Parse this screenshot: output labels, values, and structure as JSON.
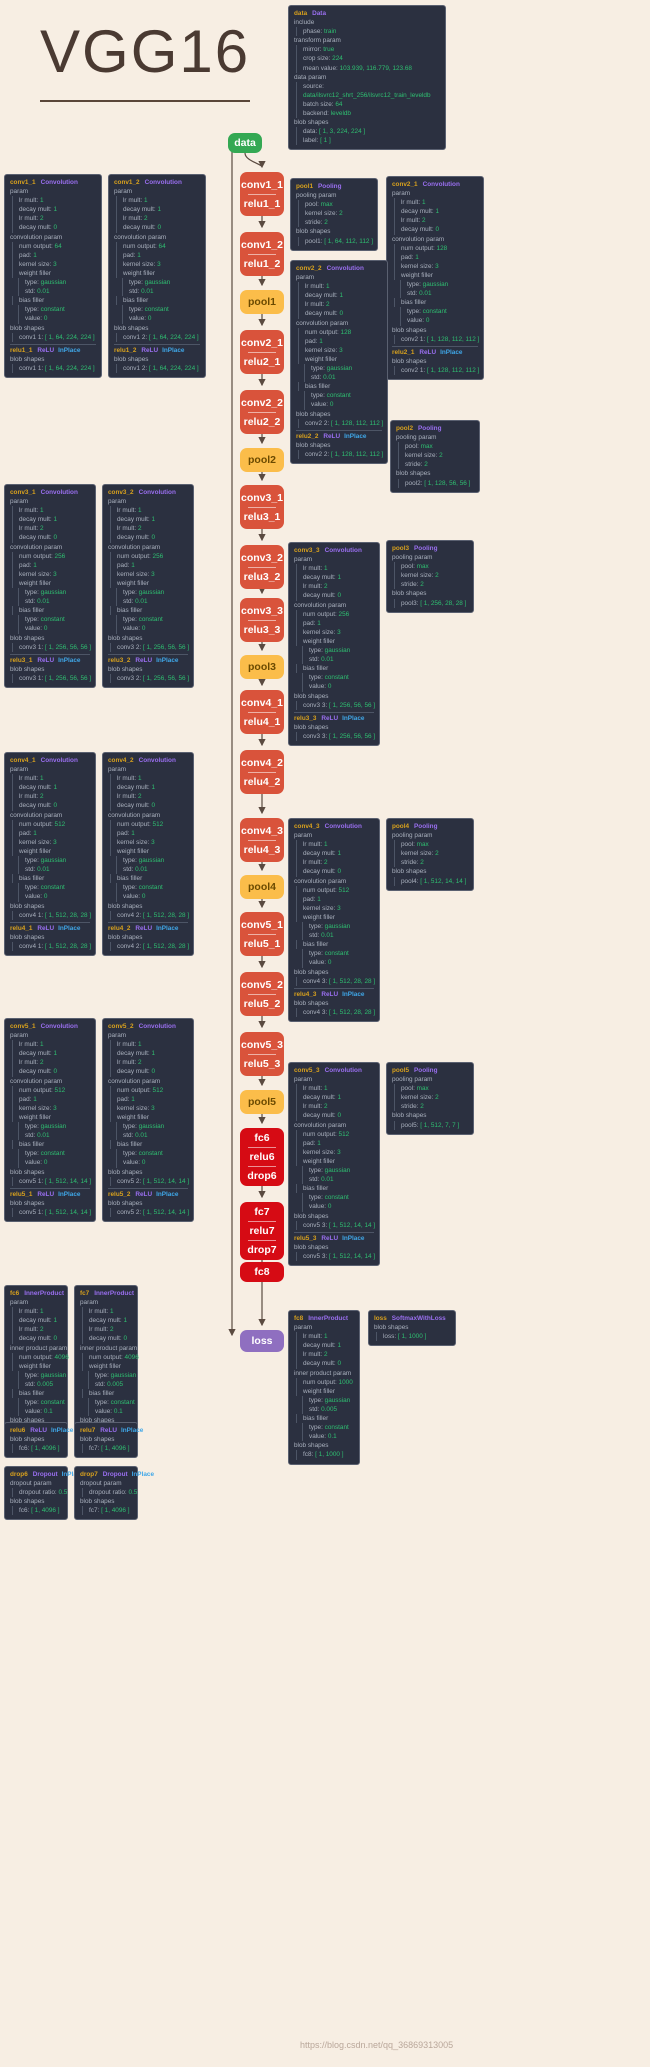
{
  "title": {
    "text": "VGG16"
  },
  "watermark": "https://blog.csdn.net/qq_36869313005",
  "colors": {
    "background": "#f7eee3",
    "card_bg": "#2b3040",
    "name": "#d8a11d",
    "type": "#9a6ff0",
    "inplace": "#3fa7e8",
    "value": "#2fbf71",
    "key": "#a9b0bd",
    "data_node": "#34a853",
    "conv_node": "#d9533b",
    "pool_node": "#fbbd4a",
    "fc_node": "#d60b14",
    "loss_node": "#8f6fc0"
  },
  "flow": [
    {
      "id": "data",
      "labels": [
        "data"
      ],
      "kind": "data"
    },
    {
      "id": "conv1_1",
      "labels": [
        "conv1_1",
        "relu1_1"
      ],
      "kind": "conv"
    },
    {
      "id": "conv1_2",
      "labels": [
        "conv1_2",
        "relu1_2"
      ],
      "kind": "conv"
    },
    {
      "id": "pool1",
      "labels": [
        "pool1"
      ],
      "kind": "pool"
    },
    {
      "id": "conv2_1",
      "labels": [
        "conv2_1",
        "relu2_1"
      ],
      "kind": "conv"
    },
    {
      "id": "conv2_2",
      "labels": [
        "conv2_2",
        "relu2_2"
      ],
      "kind": "conv"
    },
    {
      "id": "pool2",
      "labels": [
        "pool2"
      ],
      "kind": "pool"
    },
    {
      "id": "conv3_1",
      "labels": [
        "conv3_1",
        "relu3_1"
      ],
      "kind": "conv"
    },
    {
      "id": "conv3_2",
      "labels": [
        "conv3_2",
        "relu3_2"
      ],
      "kind": "conv"
    },
    {
      "id": "conv3_3",
      "labels": [
        "conv3_3",
        "relu3_3"
      ],
      "kind": "conv"
    },
    {
      "id": "pool3",
      "labels": [
        "pool3"
      ],
      "kind": "pool"
    },
    {
      "id": "conv4_1",
      "labels": [
        "conv4_1",
        "relu4_1"
      ],
      "kind": "conv"
    },
    {
      "id": "conv4_2",
      "labels": [
        "conv4_2",
        "relu4_2"
      ],
      "kind": "conv"
    },
    {
      "id": "conv4_3",
      "labels": [
        "conv4_3",
        "relu4_3"
      ],
      "kind": "conv"
    },
    {
      "id": "pool4",
      "labels": [
        "pool4"
      ],
      "kind": "pool"
    },
    {
      "id": "conv5_1",
      "labels": [
        "conv5_1",
        "relu5_1"
      ],
      "kind": "conv"
    },
    {
      "id": "conv5_2",
      "labels": [
        "conv5_2",
        "relu5_2"
      ],
      "kind": "conv"
    },
    {
      "id": "conv5_3",
      "labels": [
        "conv5_3",
        "relu5_3"
      ],
      "kind": "conv"
    },
    {
      "id": "pool5",
      "labels": [
        "pool5"
      ],
      "kind": "pool"
    },
    {
      "id": "fc6",
      "labels": [
        "fc6",
        "relu6",
        "drop6"
      ],
      "kind": "fc"
    },
    {
      "id": "fc7",
      "labels": [
        "fc7",
        "relu7",
        "drop7"
      ],
      "kind": "fc"
    },
    {
      "id": "fc8",
      "labels": [
        "fc8"
      ],
      "kind": "fc"
    },
    {
      "id": "loss",
      "labels": [
        "loss"
      ],
      "kind": "loss"
    }
  ],
  "nodes": {
    "data": {
      "name": "data",
      "type": "Data",
      "include_label": "include",
      "phase_k": "phase:",
      "phase_v": "train",
      "transform_label": "transform param",
      "mirror_k": "mirror:",
      "mirror_v": "true",
      "crop_k": "crop size:",
      "crop_v": "224",
      "mean_k": "mean value:",
      "mean_v": "103.939, 116.779, 123.68",
      "dataparam_label": "data param",
      "source_k": "source:",
      "source_v": "data/ilsvrc12_shrt_256/ilsvrc12_train_leveldb",
      "batch_k": "batch size:",
      "batch_v": "64",
      "backend_k": "backend:",
      "backend_v": "leveldb",
      "blob_label": "blob shapes",
      "blob1_k": "data:",
      "blob1_v": "[ 1, 3, 224, 224 ]",
      "blob2_k": "label:",
      "blob2_v": "[ 1 ]"
    },
    "conv1_1": {
      "name": "conv1_1",
      "type": "Convolution",
      "num_output": "64",
      "pad": "1",
      "kernel_size": "3",
      "blob_k": "conv1 1:",
      "blob_v": "[ 1, 64, 224, 224 ]",
      "relu_name": "relu1_1",
      "relu_blob_k": "conv1 1:",
      "relu_blob_v": "[ 1, 64, 224, 224 ]"
    },
    "conv1_2": {
      "name": "conv1_2",
      "type": "Convolution",
      "num_output": "64",
      "pad": "1",
      "kernel_size": "3",
      "blob_k": "conv1 2:",
      "blob_v": "[ 1, 64, 224, 224 ]",
      "relu_name": "relu1_2",
      "relu_blob_k": "conv1 2:",
      "relu_blob_v": "[ 1, 64, 224, 224 ]"
    },
    "pool1": {
      "name": "pool1",
      "type": "Pooling",
      "pool": "max",
      "kernel_size": "2",
      "stride": "2",
      "blob_k": "pool1:",
      "blob_v": "[ 1, 64, 112, 112 ]"
    },
    "conv2_1": {
      "name": "conv2_1",
      "type": "Convolution",
      "num_output": "128",
      "pad": "1",
      "kernel_size": "3",
      "blob_k": "conv2 1:",
      "blob_v": "[ 1, 128, 112, 112 ]",
      "relu_name": "relu2_1",
      "relu_blob_k": "conv2 1:",
      "relu_blob_v": "[ 1, 128, 112, 112 ]"
    },
    "conv2_2": {
      "name": "conv2_2",
      "type": "Convolution",
      "num_output": "128",
      "pad": "1",
      "kernel_size": "3",
      "blob_k": "conv2 2:",
      "blob_v": "[ 1, 128, 112, 112 ]",
      "relu_name": "relu2_2",
      "relu_blob_k": "conv2 2:",
      "relu_blob_v": "[ 1, 128, 112, 112 ]"
    },
    "pool2": {
      "name": "pool2",
      "type": "Pooling",
      "pool": "max",
      "kernel_size": "2",
      "stride": "2",
      "blob_k": "pool2:",
      "blob_v": "[ 1, 128, 56, 56 ]"
    },
    "conv3_1": {
      "name": "conv3_1",
      "type": "Convolution",
      "num_output": "256",
      "pad": "1",
      "kernel_size": "3",
      "blob_k": "conv3 1:",
      "blob_v": "[ 1, 256, 56, 56 ]",
      "relu_name": "relu3_1",
      "relu_blob_k": "conv3 1:",
      "relu_blob_v": "[ 1, 256, 56, 56 ]"
    },
    "conv3_2": {
      "name": "conv3_2",
      "type": "Convolution",
      "num_output": "256",
      "pad": "1",
      "kernel_size": "3",
      "blob_k": "conv3 2:",
      "blob_v": "[ 1, 256, 56, 56 ]",
      "relu_name": "relu3_2",
      "relu_blob_k": "conv3 2:",
      "relu_blob_v": "[ 1, 256, 56, 56 ]"
    },
    "conv3_3": {
      "name": "conv3_3",
      "type": "Convolution",
      "num_output": "256",
      "pad": "1",
      "kernel_size": "3",
      "blob_k": "conv3 3:",
      "blob_v": "[ 1, 256, 56, 56 ]",
      "relu_name": "relu3_3",
      "relu_blob_k": "conv3 3:",
      "relu_blob_v": "[ 1, 256, 56, 56 ]"
    },
    "pool3": {
      "name": "pool3",
      "type": "Pooling",
      "pool": "max",
      "kernel_size": "2",
      "stride": "2",
      "blob_k": "pool3:",
      "blob_v": "[ 1, 256, 28, 28 ]"
    },
    "conv4_1": {
      "name": "conv4_1",
      "type": "Convolution",
      "num_output": "512",
      "pad": "1",
      "kernel_size": "3",
      "blob_k": "conv4 1:",
      "blob_v": "[ 1, 512, 28, 28 ]",
      "relu_name": "relu4_1",
      "relu_blob_k": "conv4 1:",
      "relu_blob_v": "[ 1, 512, 28, 28 ]"
    },
    "conv4_2": {
      "name": "conv4_2",
      "type": "Convolution",
      "num_output": "512",
      "pad": "1",
      "kernel_size": "3",
      "blob_k": "conv4 2:",
      "blob_v": "[ 1, 512, 28, 28 ]",
      "relu_name": "relu4_2",
      "relu_blob_k": "conv4 2:",
      "relu_blob_v": "[ 1, 512, 28, 28 ]"
    },
    "conv4_3": {
      "name": "conv4_3",
      "type": "Convolution",
      "num_output": "512",
      "pad": "1",
      "kernel_size": "3",
      "blob_k": "conv4 3:",
      "blob_v": "[ 1, 512, 28, 28 ]",
      "relu_name": "relu4_3",
      "relu_blob_k": "conv4 3:",
      "relu_blob_v": "[ 1, 512, 28, 28 ]"
    },
    "pool4": {
      "name": "pool4",
      "type": "Pooling",
      "pool": "max",
      "kernel_size": "2",
      "stride": "2",
      "blob_k": "pool4:",
      "blob_v": "[ 1, 512, 14, 14 ]"
    },
    "conv5_1": {
      "name": "conv5_1",
      "type": "Convolution",
      "num_output": "512",
      "pad": "1",
      "kernel_size": "3",
      "blob_k": "conv5 1:",
      "blob_v": "[ 1, 512, 14, 14 ]",
      "relu_name": "relu5_1",
      "relu_blob_k": "conv5 1:",
      "relu_blob_v": "[ 1, 512, 14, 14 ]"
    },
    "conv5_2": {
      "name": "conv5_2",
      "type": "Convolution",
      "num_output": "512",
      "pad": "1",
      "kernel_size": "3",
      "blob_k": "conv5 2:",
      "blob_v": "[ 1, 512, 14, 14 ]",
      "relu_name": "relu5_2",
      "relu_blob_k": "conv5 2:",
      "relu_blob_v": "[ 1, 512, 14, 14 ]"
    },
    "conv5_3": {
      "name": "conv5_3",
      "type": "Convolution",
      "num_output": "512",
      "pad": "1",
      "kernel_size": "3",
      "blob_k": "conv5 3:",
      "blob_v": "[ 1, 512, 14, 14 ]",
      "relu_name": "relu5_3",
      "relu_blob_k": "conv5 3:",
      "relu_blob_v": "[ 1, 512, 14, 14 ]"
    },
    "pool5": {
      "name": "pool5",
      "type": "Pooling",
      "pool": "max",
      "kernel_size": "2",
      "stride": "2",
      "blob_k": "pool5:",
      "blob_v": "[ 1, 512, 7, 7 ]"
    },
    "fc6": {
      "name": "fc6",
      "type": "InnerProduct",
      "num_output": "4096",
      "std": "0.005",
      "bias_value": "0.1",
      "blob_k": "fc6:",
      "blob_v": "[ 1, 4096 ]",
      "relu_name": "relu6",
      "relu_blob_k": "fc6:",
      "relu_blob_v": "[ 1, 4096 ]",
      "drop_name": "drop6",
      "drop_ratio": "0.5",
      "drop_blob_k": "fc6:",
      "drop_blob_v": "[ 1, 4096 ]"
    },
    "fc7": {
      "name": "fc7",
      "type": "InnerProduct",
      "num_output": "4096",
      "std": "0.005",
      "bias_value": "0.1",
      "blob_k": "fc7:",
      "blob_v": "[ 1, 4096 ]",
      "relu_name": "relu7",
      "relu_blob_k": "fc7:",
      "relu_blob_v": "[ 1, 4096 ]",
      "drop_name": "drop7",
      "drop_ratio": "0.5",
      "drop_blob_k": "fc7:",
      "drop_blob_v": "[ 1, 4096 ]"
    },
    "fc8": {
      "name": "fc8",
      "type": "InnerProduct",
      "num_output": "1000",
      "std": "0.005",
      "bias_value": "0.1",
      "blob_k": "fc8:",
      "blob_v": "[ 1, 1000 ]"
    },
    "loss": {
      "name": "loss",
      "type": "SoftmaxWithLoss",
      "blob_k": "loss:",
      "blob_v": "[ 1, 1000 ]"
    }
  },
  "labels": {
    "param": "param",
    "lr_mult": "lr mult:",
    "decay_mult": "decay mult:",
    "lr1": "1",
    "decay1": "1",
    "lr2": "2",
    "decay2": "0",
    "convolution_param": "convolution param",
    "inner_product_param": "inner product param",
    "num_output": "num output:",
    "pad": "pad:",
    "kernel_size": "kernel size:",
    "weight_filler": "weight filler",
    "type": "type:",
    "gaussian": "gaussian",
    "std": "std:",
    "std_conv": "0.01",
    "bias_filler": "bias filler",
    "constant": "constant",
    "value": "value:",
    "value_zero": "0",
    "blob_shapes": "blob shapes",
    "relu_type": "ReLU",
    "inplace": "InPlace",
    "pooling_param": "pooling param",
    "pool": "pool:",
    "max": "max",
    "stride": "stride:",
    "dropout_param": "dropout param",
    "dropout_ratio": "dropout ratio:",
    "dropout_type": "Dropout"
  }
}
